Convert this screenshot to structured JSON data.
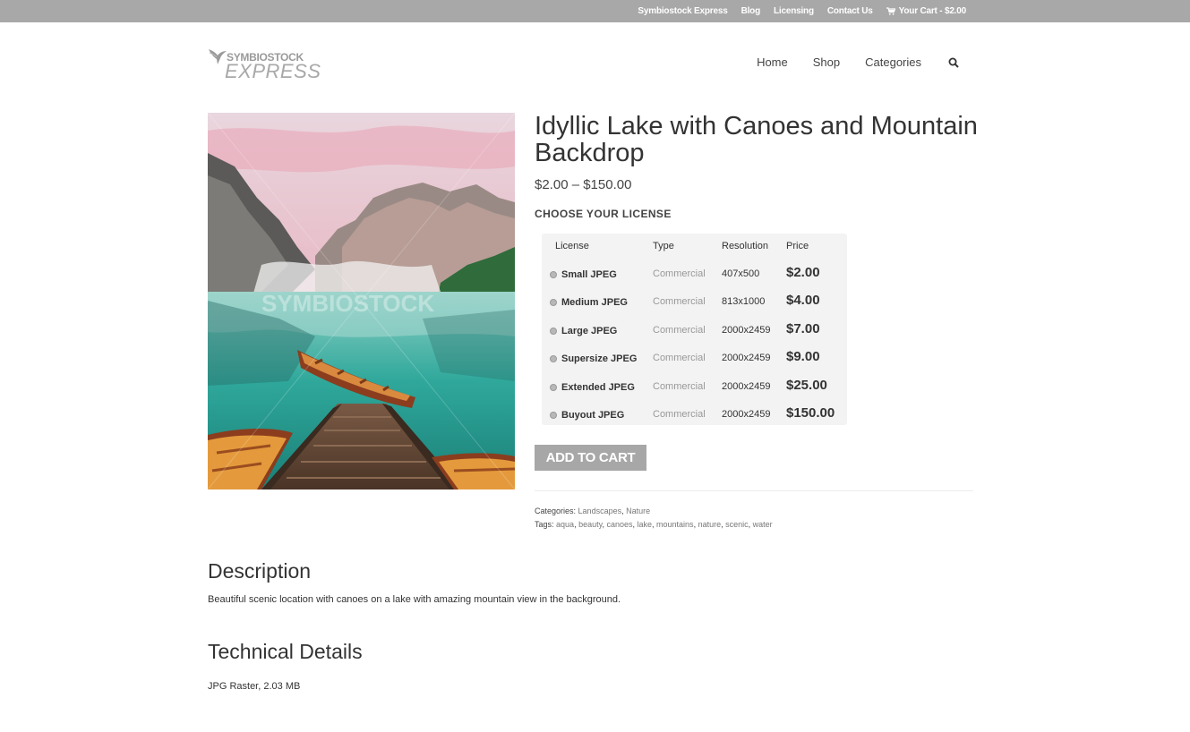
{
  "topbar": {
    "links": [
      "Symbiostock Express",
      "Blog",
      "Licensing",
      "Contact Us"
    ],
    "cart_label": "Your Cart - $2.00",
    "cart_icon": "cart-icon"
  },
  "logo": {
    "top_text": "SYMBIOSTOCK",
    "bottom_text": "EXPRESS",
    "icon": "bird-icon"
  },
  "nav": {
    "items": [
      "Home",
      "Shop",
      "Categories"
    ],
    "search_icon": "search-icon"
  },
  "product": {
    "title": "Idyllic Lake with Canoes and Mountain Backdrop",
    "price_range": "$2.00 – $150.00",
    "image_watermark": "SYMBIOSTOCK",
    "license_heading": "CHOOSE YOUR LICENSE",
    "license_table": {
      "headers": [
        "License",
        "Type",
        "Resolution",
        "Price"
      ],
      "rows": [
        {
          "name": "Small JPEG",
          "type": "Commercial",
          "resolution": "407x500",
          "price": "$2.00"
        },
        {
          "name": "Medium JPEG",
          "type": "Commercial",
          "resolution": "813x1000",
          "price": "$4.00"
        },
        {
          "name": "Large JPEG",
          "type": "Commercial",
          "resolution": "2000x2459",
          "price": "$7.00"
        },
        {
          "name": "Supersize JPEG",
          "type": "Commercial",
          "resolution": "2000x2459",
          "price": "$9.00"
        },
        {
          "name": "Extended JPEG",
          "type": "Commercial",
          "resolution": "2000x2459",
          "price": "$25.00"
        },
        {
          "name": "Buyout JPEG",
          "type": "Commercial",
          "resolution": "2000x2459",
          "price": "$150.00"
        }
      ]
    },
    "add_to_cart_label": "ADD TO CART",
    "categories_label": "Categories:",
    "categories": [
      "Landscapes",
      "Nature"
    ],
    "tags_label": "Tags:",
    "tags": [
      "aqua",
      "beauty",
      "canoes",
      "lake",
      "mountains",
      "nature",
      "scenic",
      "water"
    ]
  },
  "description": {
    "heading": "Description",
    "text": "Beautiful scenic location with canoes on a lake with amazing mountain view in the background."
  },
  "technical": {
    "heading": "Technical Details",
    "text": "JPG Raster, 2.03 MB"
  },
  "colors": {
    "topbar_bg": "#a8a8a8",
    "button_bg": "#a7a7a7",
    "table_bg": "#f3f3f3"
  }
}
